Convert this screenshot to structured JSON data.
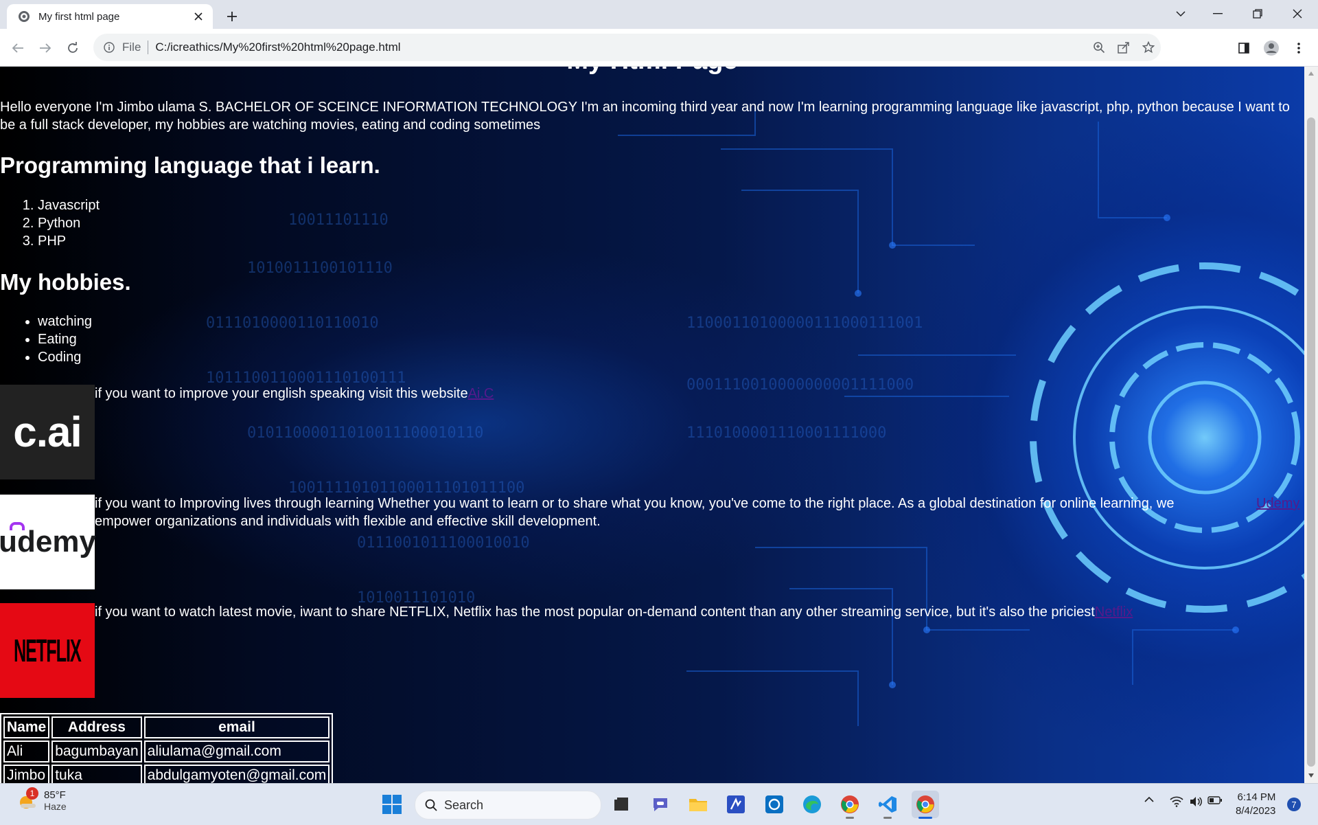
{
  "browser": {
    "tab_title": "My first html page",
    "scheme": "File",
    "url": "C:/icreathics/My%20first%20html%20page.html"
  },
  "page": {
    "heading": "My Html Page",
    "intro": "Hello everyone I'm Jimbo ulama S. BACHELOR OF SCEINCE INFORMATION TECHNOLOGY I'm an incoming third year and now I'm learning programming language like javascript, php, python because I want to be a full stack developer, my hobbies are watching movies, eating and coding sometimes",
    "languages_heading": "Programming language that i learn.",
    "languages": [
      "Javascript",
      "Python",
      "PHP"
    ],
    "hobbies_heading": "My hobbies.",
    "hobbies": [
      "watching",
      "Eating",
      "Coding"
    ],
    "sites": [
      {
        "logo": "c.ai",
        "text": "if you want to improve your english speaking visit this website",
        "link": "Ai.C"
      },
      {
        "logo": "udemy",
        "text": "if you want to Improving lives through learning Whether you want to learn or to share what you know, you've come to the right place. As a global destination for online learning, we empower organizations and individuals with flexible and effective skill development.",
        "link": "Udemy"
      },
      {
        "logo": "NETFLIX",
        "text": "if you want to watch latest movie, iwant to share NETFLIX, Netflix has the most popular on-demand content than any other streaming service, but it's also the priciest",
        "link": "Netflix"
      }
    ],
    "table": {
      "headers": [
        "Name",
        "Address",
        "email"
      ],
      "rows": [
        [
          "Ali",
          "bagumbayan",
          "aliulama@gmail.com"
        ],
        [
          "Jimbo",
          "tuka",
          "abdulgamyoten@gmail.com"
        ]
      ]
    }
  },
  "taskbar": {
    "weather_badge": "1",
    "temperature": "85°F",
    "condition": "Haze",
    "search_label": "Search",
    "time": "6:14 PM",
    "date": "8/4/2023",
    "notification_count": "7"
  },
  "colors": {
    "link": "#551a8b",
    "netflix_red": "#e50914",
    "tab_bar": "#dfe3eb"
  }
}
